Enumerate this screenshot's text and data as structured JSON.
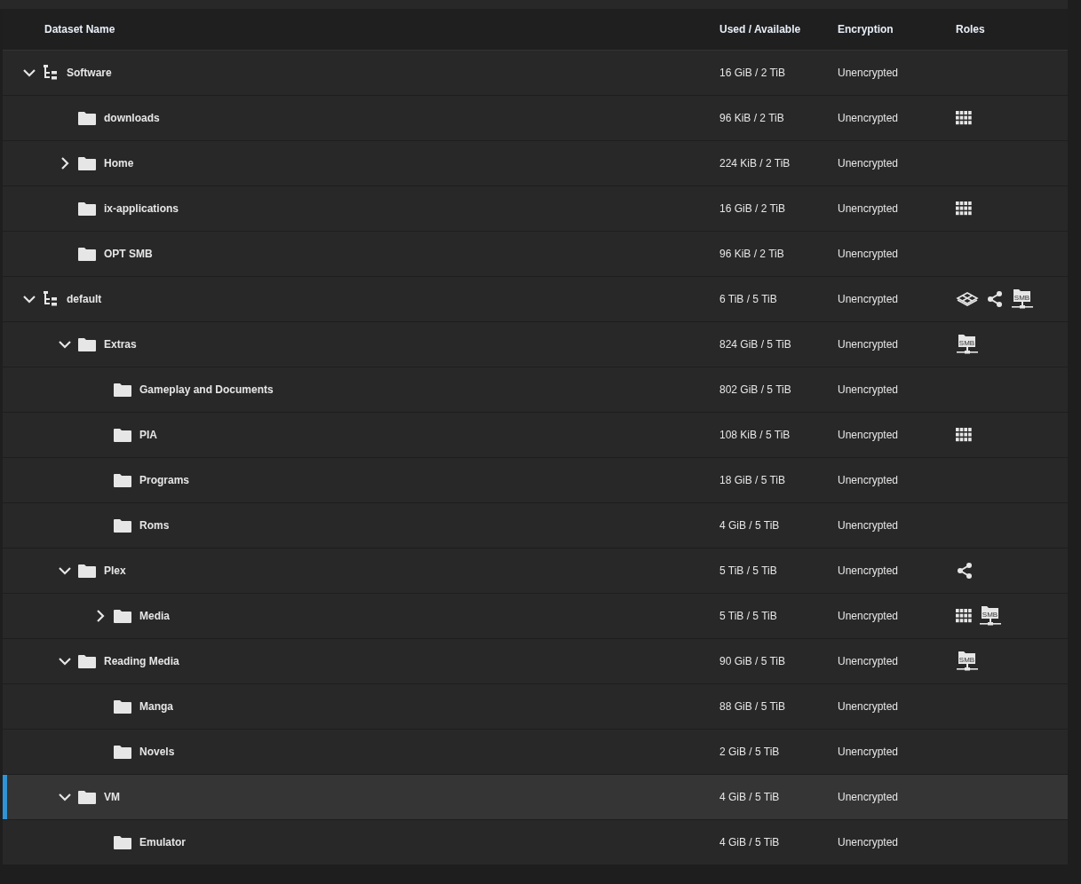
{
  "table": {
    "columns": [
      "Dataset Name",
      "Used / Available",
      "Encryption",
      "Roles"
    ],
    "rows": [
      {
        "kind": "pool",
        "name": "Software",
        "used": "16 GiB / 2 TiB",
        "encryption": "Unencrypted",
        "expanded": true,
        "selected": false,
        "roles": [],
        "children": [
          {
            "kind": "dataset",
            "name": "downloads",
            "used": "96 KiB / 2 TiB",
            "encryption": "Unencrypted",
            "selected": false,
            "roles": [
              {
                "kind": "apps"
              }
            ]
          },
          {
            "kind": "dataset",
            "name": "Home",
            "used": "224 KiB / 2 TiB",
            "encryption": "Unencrypted",
            "expanded": false,
            "selected": false
          },
          {
            "kind": "dataset",
            "name": "ix-applications",
            "used": "16 GiB / 2 TiB",
            "encryption": "Unencrypted",
            "selected": false,
            "roles": [
              {
                "kind": "apps"
              }
            ]
          },
          {
            "kind": "dataset",
            "name": "OPT SMB",
            "used": "96 KiB / 2 TiB",
            "encryption": "Unencrypted",
            "selected": false
          }
        ]
      },
      {
        "kind": "pool",
        "name": "default",
        "used": "6 TiB / 5 TiB",
        "encryption": "Unencrypted",
        "expanded": true,
        "selected": false,
        "roles": [
          {
            "kind": "vm"
          },
          {
            "kind": "share"
          },
          {
            "kind": "smb",
            "label": "SMB"
          }
        ],
        "children": [
          {
            "kind": "dataset",
            "name": "Extras",
            "used": "824 GiB / 5 TiB",
            "encryption": "Unencrypted",
            "expanded": true,
            "selected": false,
            "roles": [
              {
                "kind": "smb",
                "label": "SMB"
              }
            ],
            "children": [
              {
                "kind": "dataset",
                "name": "Gameplay and Documents",
                "used": "802 GiB / 5 TiB",
                "encryption": "Unencrypted",
                "selected": false
              },
              {
                "kind": "dataset",
                "name": "PIA",
                "used": "108 KiB / 5 TiB",
                "encryption": "Unencrypted",
                "selected": false,
                "roles": [
                  {
                    "kind": "apps"
                  }
                ]
              },
              {
                "kind": "dataset",
                "name": "Programs",
                "used": "18 GiB / 5 TiB",
                "encryption": "Unencrypted",
                "selected": false
              },
              {
                "kind": "dataset",
                "name": "Roms",
                "used": "4 GiB / 5 TiB",
                "encryption": "Unencrypted",
                "selected": false
              }
            ]
          },
          {
            "kind": "dataset",
            "name": "Plex",
            "used": "5 TiB / 5 TiB",
            "encryption": "Unencrypted",
            "expanded": true,
            "selected": false,
            "roles": [
              {
                "kind": "share"
              }
            ],
            "children": [
              {
                "kind": "dataset",
                "name": "Media",
                "used": "5 TiB / 5 TiB",
                "encryption": "Unencrypted",
                "expanded": false,
                "selected": false,
                "roles": [
                  {
                    "kind": "apps"
                  },
                  {
                    "kind": "smb",
                    "label": "SMB"
                  }
                ]
              }
            ]
          },
          {
            "kind": "dataset",
            "name": "Reading Media",
            "used": "90 GiB / 5 TiB",
            "encryption": "Unencrypted",
            "expanded": true,
            "selected": false,
            "roles": [
              {
                "kind": "smb",
                "label": "SMB"
              }
            ],
            "children": [
              {
                "kind": "dataset",
                "name": "Manga",
                "used": "88 GiB / 5 TiB",
                "encryption": "Unencrypted",
                "selected": false
              },
              {
                "kind": "dataset",
                "name": "Novels",
                "used": "2 GiB / 5 TiB",
                "encryption": "Unencrypted",
                "selected": false
              }
            ]
          },
          {
            "kind": "dataset",
            "name": "VM",
            "used": "4 GiB / 5 TiB",
            "encryption": "Unencrypted",
            "expanded": true,
            "selected": true,
            "children": [
              {
                "kind": "dataset",
                "name": "Emulator",
                "used": "4 GiB / 5 TiB",
                "encryption": "Unencrypted",
                "selected": false
              }
            ]
          }
        ]
      }
    ]
  }
}
